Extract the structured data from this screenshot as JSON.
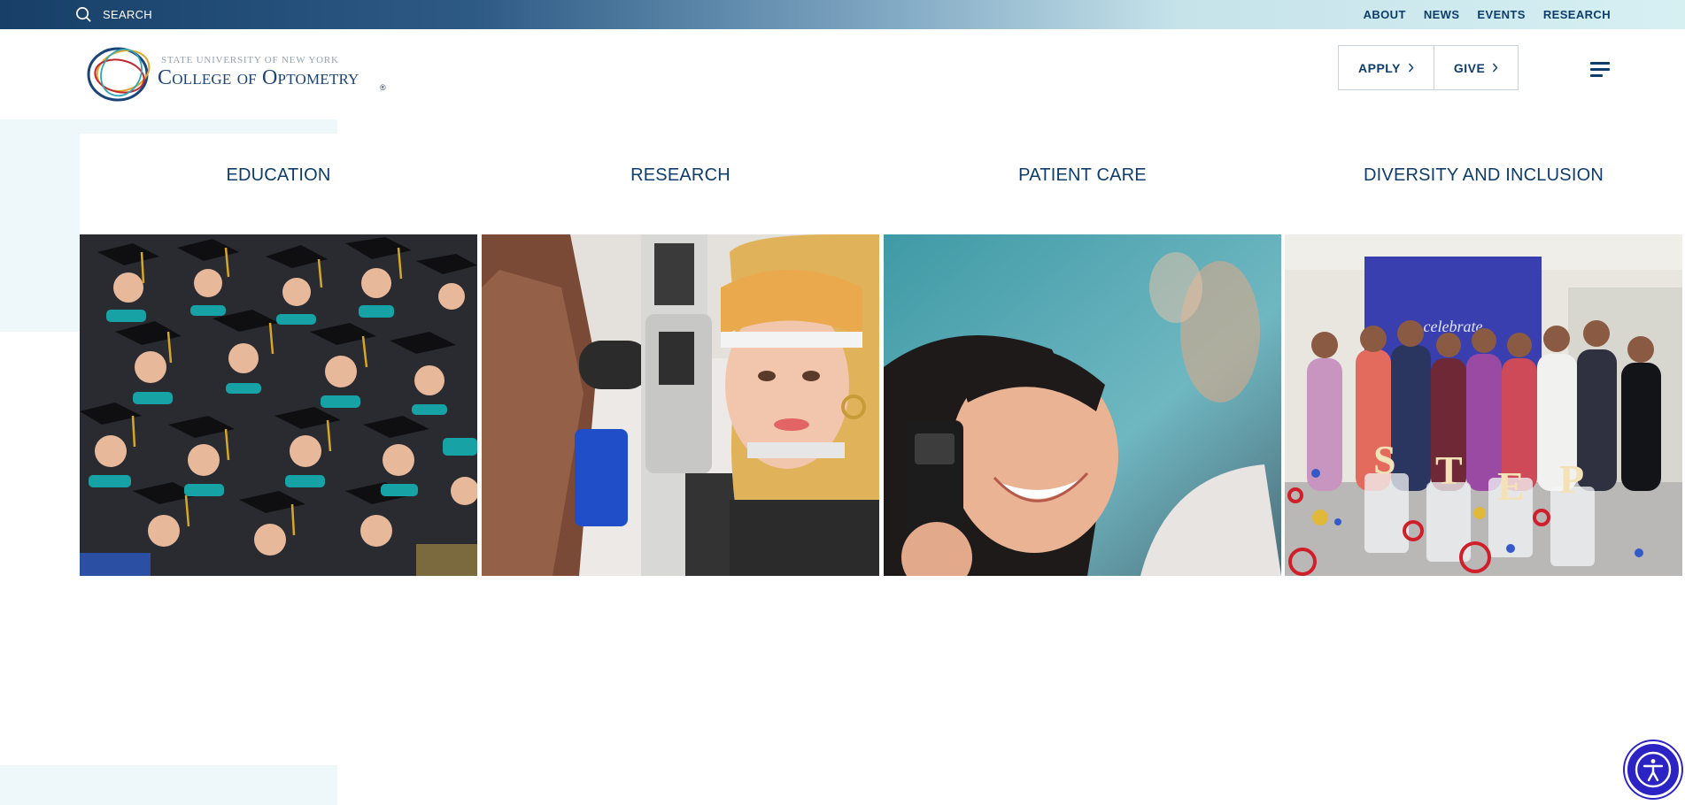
{
  "topbar": {
    "search_label": "SEARCH",
    "links": [
      "ABOUT",
      "NEWS",
      "EVENTS",
      "RESEARCH"
    ]
  },
  "header": {
    "logo_line1": "STATE UNIVERSITY OF NEW YORK",
    "logo_line2": "College of Optometry",
    "logo_reg": "®",
    "apply_label": "APPLY",
    "give_label": "GIVE"
  },
  "cards": [
    {
      "label": "EDUCATION",
      "image": "graduates-in-caps-and-gowns"
    },
    {
      "label": "RESEARCH",
      "image": "patient-at-slit-lamp"
    },
    {
      "label": "PATIENT CARE",
      "image": "smiling-student-with-ophthalmoscope"
    },
    {
      "label": "DIVERSITY AND INCLUSION",
      "image": "group-photo-step-letters"
    }
  ],
  "icons": {
    "search": "search-icon",
    "chevron": "chevron-right-icon",
    "menu": "hamburger-menu-icon",
    "accessibility": "accessibility-icon"
  },
  "colors": {
    "brand_navy": "#0f3d6b",
    "topbar_gradient_start": "#173f68",
    "topbar_gradient_end": "#d6f0f2",
    "accent_bg": "#eef7f9",
    "accessibility_button": "#2c23c4"
  }
}
